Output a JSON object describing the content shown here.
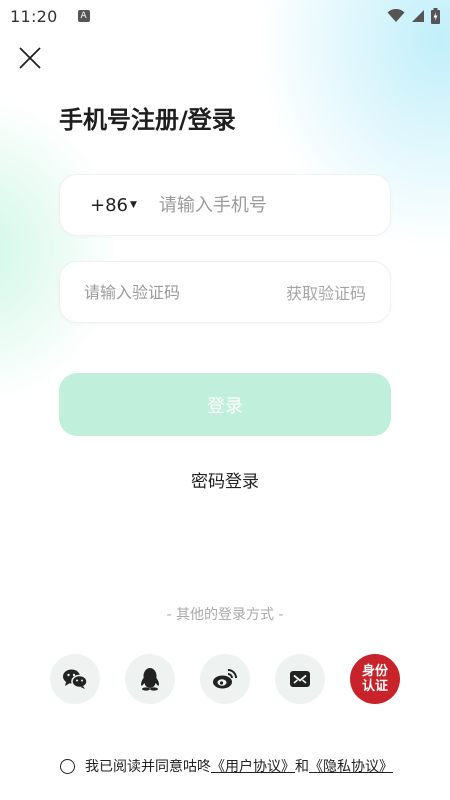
{
  "status_bar": {
    "time": "11:20",
    "notification_letter": "A"
  },
  "header": {
    "title": "手机号注册/登录"
  },
  "phone": {
    "country_code": "+86",
    "placeholder": "请输入手机号",
    "value": ""
  },
  "code": {
    "placeholder": "请输入验证码",
    "value": "",
    "get_code_label": "获取验证码"
  },
  "login_button_label": "登录",
  "password_login_label": "密码登录",
  "other_methods_title": "- 其他的登录方式 -",
  "social": [
    {
      "name": "wechat",
      "icon": "wechat-icon"
    },
    {
      "name": "qq",
      "icon": "qq-icon"
    },
    {
      "name": "weibo",
      "icon": "weibo-icon"
    },
    {
      "name": "mail",
      "icon": "mail-icon"
    },
    {
      "name": "id-auth",
      "icon": "id-auth-icon",
      "label_line1": "身份",
      "label_line2": "认证"
    }
  ],
  "agreement": {
    "prefix": "我已阅读并同意咕咚",
    "user_agreement": "《用户协议》",
    "and": "和",
    "privacy_policy": "《隐私协议》"
  },
  "colors": {
    "accent": "#c0f0dc",
    "id_auth_red": "#c8232a",
    "social_bg": "#eef3f1"
  }
}
